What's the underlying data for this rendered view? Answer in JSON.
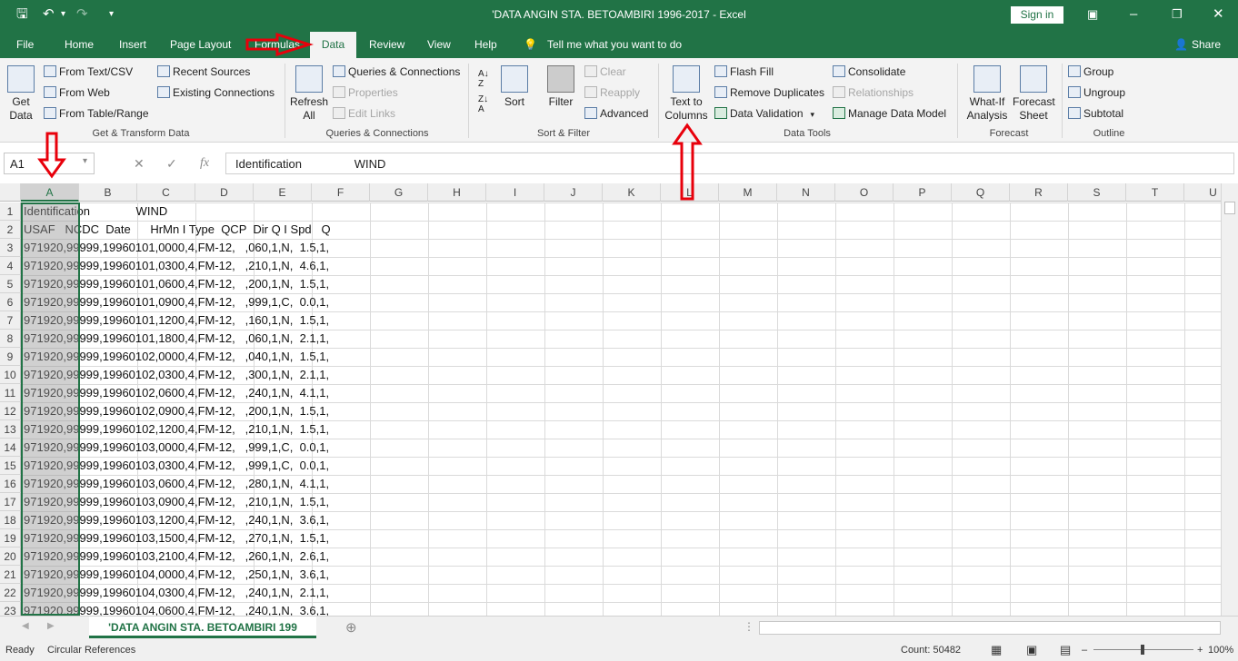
{
  "title": "'DATA ANGIN STA. BETOAMBIRI 1996-2017  -  Excel",
  "signin": "Sign in",
  "menu": {
    "file": "File",
    "home": "Home",
    "insert": "Insert",
    "page_layout": "Page Layout",
    "formulas": "Formulas",
    "data": "Data",
    "review": "Review",
    "view": "View",
    "help": "Help",
    "tell_me": "Tell me what you want to do",
    "share": "Share"
  },
  "ribbon": {
    "get_data": "Get Data",
    "from_text_csv": "From Text/CSV",
    "from_web": "From Web",
    "from_table": "From Table/Range",
    "recent_sources": "Recent Sources",
    "existing_connections": "Existing Connections",
    "group_get_transform": "Get & Transform Data",
    "refresh_all": "Refresh All",
    "queries_connections": "Queries & Connections",
    "properties": "Properties",
    "edit_links": "Edit Links",
    "group_queries": "Queries & Connections",
    "sort": "Sort",
    "filter": "Filter",
    "clear": "Clear",
    "reapply": "Reapply",
    "advanced": "Advanced",
    "group_sort_filter": "Sort & Filter",
    "text_to_columns": "Text to Columns",
    "flash_fill": "Flash Fill",
    "remove_duplicates": "Remove Duplicates",
    "data_validation": "Data Validation",
    "consolidate": "Consolidate",
    "relationships": "Relationships",
    "manage_data_model": "Manage Data Model",
    "group_data_tools": "Data Tools",
    "what_if": "What-If Analysis",
    "forecast_sheet": "Forecast Sheet",
    "group_forecast": "Forecast",
    "group": "Group",
    "ungroup": "Ungroup",
    "subtotal": "Subtotal",
    "group_outline": "Outline"
  },
  "formula_bar": {
    "name_box": "A1",
    "fx": "fx",
    "content": "Identification                WIND"
  },
  "columns": [
    "A",
    "B",
    "C",
    "D",
    "E",
    "F",
    "G",
    "H",
    "I",
    "J",
    "K",
    "L",
    "M",
    "N",
    "O",
    "P",
    "Q",
    "R",
    "S",
    "T",
    "U"
  ],
  "rows": [
    {
      "n": "1",
      "text": "Identification              WIND"
    },
    {
      "n": "2",
      "text": "USAF   NCDC  Date      HrMn I Type  QCP  Dir Q I Spd   Q"
    },
    {
      "n": "3",
      "text": "971920,99999,19960101,0000,4,FM-12,   ,060,1,N,  1.5,1,"
    },
    {
      "n": "4",
      "text": "971920,99999,19960101,0300,4,FM-12,   ,210,1,N,  4.6,1,"
    },
    {
      "n": "5",
      "text": "971920,99999,19960101,0600,4,FM-12,   ,200,1,N,  1.5,1,"
    },
    {
      "n": "6",
      "text": "971920,99999,19960101,0900,4,FM-12,   ,999,1,C,  0.0,1,"
    },
    {
      "n": "7",
      "text": "971920,99999,19960101,1200,4,FM-12,   ,160,1,N,  1.5,1,"
    },
    {
      "n": "8",
      "text": "971920,99999,19960101,1800,4,FM-12,   ,060,1,N,  2.1,1,"
    },
    {
      "n": "9",
      "text": "971920,99999,19960102,0000,4,FM-12,   ,040,1,N,  1.5,1,"
    },
    {
      "n": "10",
      "text": "971920,99999,19960102,0300,4,FM-12,   ,300,1,N,  2.1,1,"
    },
    {
      "n": "11",
      "text": "971920,99999,19960102,0600,4,FM-12,   ,240,1,N,  4.1,1,"
    },
    {
      "n": "12",
      "text": "971920,99999,19960102,0900,4,FM-12,   ,200,1,N,  1.5,1,"
    },
    {
      "n": "13",
      "text": "971920,99999,19960102,1200,4,FM-12,   ,210,1,N,  1.5,1,"
    },
    {
      "n": "14",
      "text": "971920,99999,19960103,0000,4,FM-12,   ,999,1,C,  0.0,1,"
    },
    {
      "n": "15",
      "text": "971920,99999,19960103,0300,4,FM-12,   ,999,1,C,  0.0,1,"
    },
    {
      "n": "16",
      "text": "971920,99999,19960103,0600,4,FM-12,   ,280,1,N,  4.1,1,"
    },
    {
      "n": "17",
      "text": "971920,99999,19960103,0900,4,FM-12,   ,210,1,N,  1.5,1,"
    },
    {
      "n": "18",
      "text": "971920,99999,19960103,1200,4,FM-12,   ,240,1,N,  3.6,1,"
    },
    {
      "n": "19",
      "text": "971920,99999,19960103,1500,4,FM-12,   ,270,1,N,  1.5,1,"
    },
    {
      "n": "20",
      "text": "971920,99999,19960103,2100,4,FM-12,   ,260,1,N,  2.6,1,"
    },
    {
      "n": "21",
      "text": "971920,99999,19960104,0000,4,FM-12,   ,250,1,N,  3.6,1,"
    },
    {
      "n": "22",
      "text": "971920,99999,19960104,0300,4,FM-12,   ,240,1,N,  2.1,1,"
    },
    {
      "n": "23",
      "text": "971920,99999,19960104,0600,4,FM-12,   ,240,1,N,  3.6,1,"
    }
  ],
  "sheet_tab": "'DATA ANGIN STA. BETOAMBIRI 199",
  "status": {
    "ready": "Ready",
    "circular": "Circular References",
    "count": "Count: 50482",
    "zoom": "100%"
  },
  "colors": {
    "excel_green": "#217346",
    "annotation_red": "#e8000b"
  }
}
